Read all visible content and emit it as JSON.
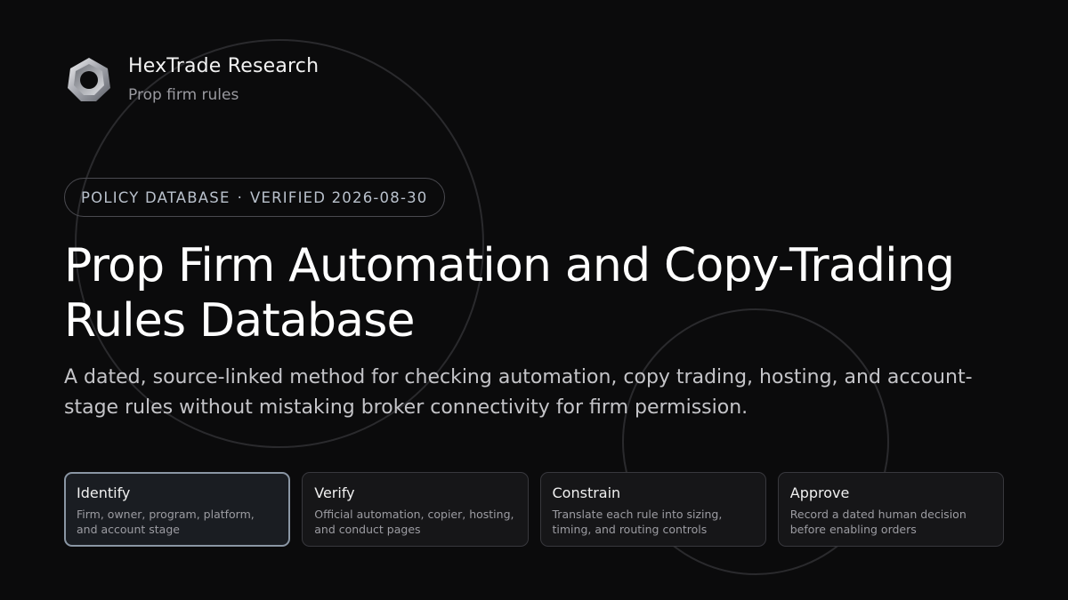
{
  "brand": {
    "name": "HexTrade Research",
    "subtitle": "Prop firm rules",
    "logo_icon": "hexagon-ring-logo-icon"
  },
  "badge": {
    "category": "POLICY DATABASE",
    "separator": "·",
    "verified": "VERIFIED 2026-08-30"
  },
  "hero": {
    "title": "Prop Firm Automation and Copy-Trading Rules Database",
    "description": "A dated, source-linked method for checking automation, copy trading, hosting, and account-stage rules without mistaking broker connectivity for firm permission."
  },
  "steps": [
    {
      "title": "Identify",
      "description": "Firm, owner, program, platform, and account stage",
      "active": true
    },
    {
      "title": "Verify",
      "description": "Official automation, copier, hosting, and conduct pages",
      "active": false
    },
    {
      "title": "Constrain",
      "description": "Translate each rule into sizing, timing, and routing controls",
      "active": false
    },
    {
      "title": "Approve",
      "description": "Record a dated human decision before enabling orders",
      "active": false
    }
  ],
  "colors": {
    "background": "#0b0b0c",
    "active_border": "#8a96a4",
    "badge_text": "#b9c1cc"
  }
}
